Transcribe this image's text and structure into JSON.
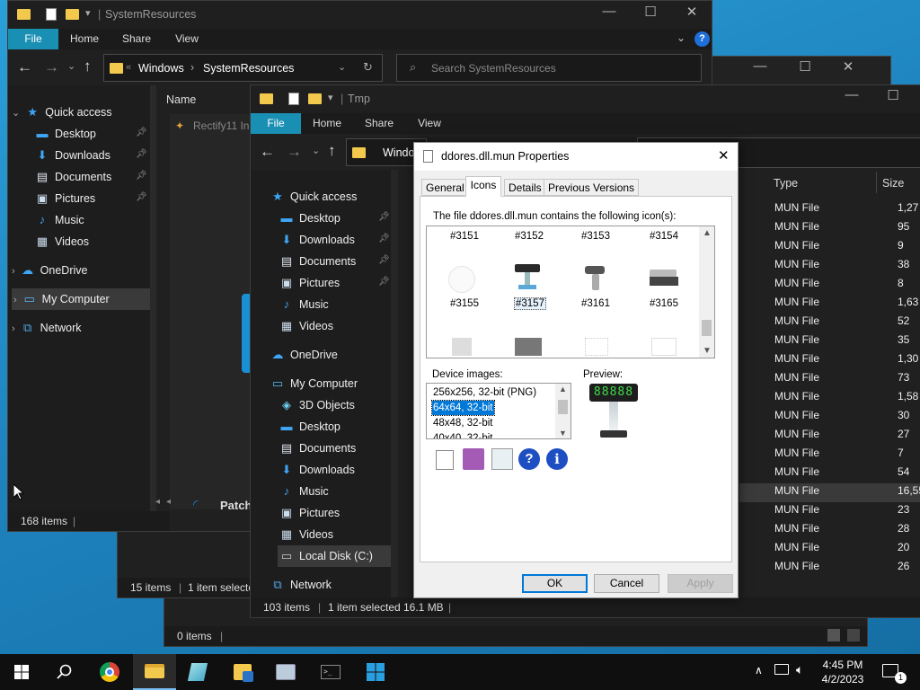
{
  "win1": {
    "title": "SystemResources",
    "tabs": [
      "File",
      "Home",
      "Share",
      "View"
    ],
    "path_root": "Windows",
    "path_leaf": "SystemResources",
    "search_placeholder": "Search SystemResources",
    "nav_items": [
      {
        "label": "Quick access",
        "icon": "star-icon"
      },
      {
        "label": "Desktop",
        "icon": "desktop-icon",
        "pinned": true
      },
      {
        "label": "Downloads",
        "icon": "download-icon",
        "pinned": true
      },
      {
        "label": "Documents",
        "icon": "document-icon",
        "pinned": true
      },
      {
        "label": "Pictures",
        "icon": "pictures-icon",
        "pinned": true
      },
      {
        "label": "Music",
        "icon": "music-icon"
      },
      {
        "label": "Videos",
        "icon": "videos-icon"
      },
      {
        "label": "OneDrive",
        "icon": "cloud-icon"
      },
      {
        "label": "My Computer",
        "icon": "computer-icon"
      },
      {
        "label": "Network",
        "icon": "network-icon"
      }
    ],
    "col_name": "Name",
    "first_file": "Rectify11 Ins",
    "patch_label": "Patch",
    "status_items": "168 items"
  },
  "win_mid": {
    "status_items": "15 items",
    "status_selected": "1 item selecte"
  },
  "win_back": {
    "status_items": "0 items"
  },
  "win2": {
    "title": "Tmp",
    "tabs": [
      "File",
      "Home",
      "Share",
      "View"
    ],
    "path_root": "Windo",
    "nav_items": [
      {
        "label": "Quick access",
        "icon": "star-icon"
      },
      {
        "label": "Desktop",
        "icon": "desktop-icon",
        "pinned": true
      },
      {
        "label": "Downloads",
        "icon": "download-icon",
        "pinned": true
      },
      {
        "label": "Documents",
        "icon": "document-icon",
        "pinned": true
      },
      {
        "label": "Pictures",
        "icon": "pictures-icon",
        "pinned": true
      },
      {
        "label": "Music",
        "icon": "music-icon"
      },
      {
        "label": "Videos",
        "icon": "videos-icon"
      },
      {
        "label": "OneDrive",
        "icon": "cloud-icon"
      },
      {
        "label": "My Computer",
        "icon": "computer-icon"
      },
      {
        "label": "3D Objects",
        "icon": "cube-icon"
      },
      {
        "label": "Desktop",
        "icon": "desktop-icon"
      },
      {
        "label": "Documents",
        "icon": "document-icon"
      },
      {
        "label": "Downloads",
        "icon": "download-icon"
      },
      {
        "label": "Music",
        "icon": "music-icon"
      },
      {
        "label": "Pictures",
        "icon": "pictures-icon"
      },
      {
        "label": "Videos",
        "icon": "videos-icon"
      },
      {
        "label": "Local Disk (C:)",
        "icon": "drive-icon"
      },
      {
        "label": "Network",
        "icon": "network-icon"
      }
    ],
    "col_type": "Type",
    "col_size": "Size",
    "rows": [
      {
        "type": "MUN File",
        "size": "1,27"
      },
      {
        "type": "MUN File",
        "size": "95"
      },
      {
        "type": "MUN File",
        "size": "9"
      },
      {
        "type": "MUN File",
        "size": "38"
      },
      {
        "type": "MUN File",
        "size": "8"
      },
      {
        "type": "MUN File",
        "size": "1,63"
      },
      {
        "type": "MUN File",
        "size": "52"
      },
      {
        "type": "MUN File",
        "size": "35"
      },
      {
        "type": "MUN File",
        "size": "1,30"
      },
      {
        "type": "MUN File",
        "size": "73"
      },
      {
        "type": "MUN File",
        "size": "1,58"
      },
      {
        "type": "MUN File",
        "size": "30"
      },
      {
        "type": "MUN File",
        "size": "27"
      },
      {
        "type": "MUN File",
        "size": "7"
      },
      {
        "type": "MUN File",
        "size": "54"
      },
      {
        "type": "MUN File",
        "size": "16,55"
      },
      {
        "type": "MUN File",
        "size": "23"
      },
      {
        "type": "MUN File",
        "size": "28"
      },
      {
        "type": "MUN File",
        "size": "20"
      },
      {
        "type": "MUN File",
        "size": "26"
      }
    ],
    "status_items": "103 items",
    "status_selected": "1 item selected",
    "status_size": "16.1 MB"
  },
  "dialog": {
    "title": "ddores.dll.mun Properties",
    "tabs": [
      "General",
      "Icons",
      "Details",
      "Previous Versions"
    ],
    "active_tab": "Icons",
    "intro": "The file ddores.dll.mun contains the following icon(s):",
    "icons_row1": [
      "#3151",
      "#3152",
      "#3153",
      "#3154"
    ],
    "icons_row2": [
      "#3155",
      "#3157",
      "#3161",
      "#3165"
    ],
    "selected_icon": "#3157",
    "device_images_label": "Device images:",
    "device_images": [
      "256x256, 32-bit (PNG)",
      "64x64, 32-bit",
      "48x48, 32-bit",
      "40x40, 32-bit"
    ],
    "selected_image": "64x64, 32-bit",
    "preview_label": "Preview:",
    "preview_digits": "88888",
    "ok": "OK",
    "cancel": "Cancel",
    "apply": "Apply"
  },
  "taskbar": {
    "time": "4:45 PM",
    "date": "4/2/2023",
    "notification_count": "1"
  },
  "colors": {
    "accent": "#0078d7",
    "explorer_dark": "#202020",
    "file_tab": "#1a8fb4",
    "folder": "#f2c94c"
  }
}
